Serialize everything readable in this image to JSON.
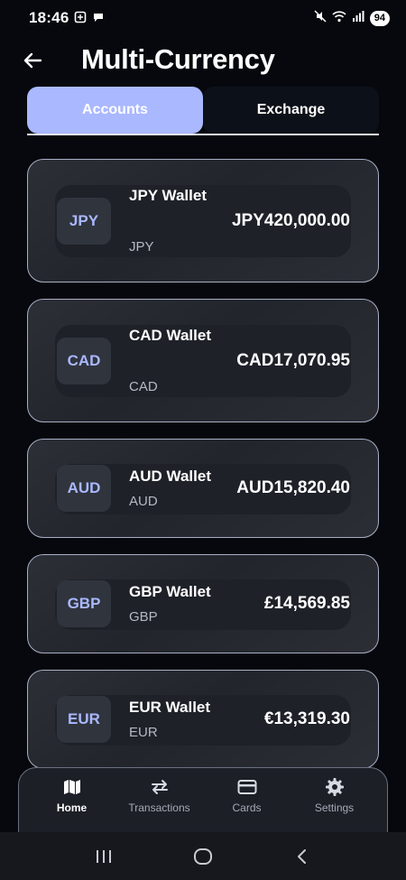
{
  "status_bar": {
    "time": "18:46",
    "battery": "94"
  },
  "header": {
    "title": "Multi-Currency"
  },
  "tabs": [
    {
      "label": "Accounts",
      "active": true
    },
    {
      "label": "Exchange",
      "active": false
    }
  ],
  "accounts": [
    {
      "code": "JPY",
      "name": "JPY Wallet",
      "sub": "JPY",
      "balance": "JPY420,000.00"
    },
    {
      "code": "CAD",
      "name": "CAD Wallet",
      "sub": "CAD",
      "balance": "CAD17,070.95"
    },
    {
      "code": "AUD",
      "name": "AUD Wallet",
      "sub": "AUD",
      "balance": "AUD15,820.40"
    },
    {
      "code": "GBP",
      "name": "GBP Wallet",
      "sub": "GBP",
      "balance": "£14,569.85"
    },
    {
      "code": "EUR",
      "name": "EUR Wallet",
      "sub": "EUR",
      "balance": "€13,319.30"
    }
  ],
  "bottom_nav": [
    {
      "label": "Home",
      "icon": "map-icon",
      "active": true
    },
    {
      "label": "Transactions",
      "icon": "swap-icon",
      "active": false
    },
    {
      "label": "Cards",
      "icon": "card-icon",
      "active": false
    },
    {
      "label": "Settings",
      "icon": "gear-icon",
      "active": false
    }
  ],
  "colors": {
    "accent": "#aab8ff",
    "background": "#06080d",
    "card": "#2a2d34"
  }
}
